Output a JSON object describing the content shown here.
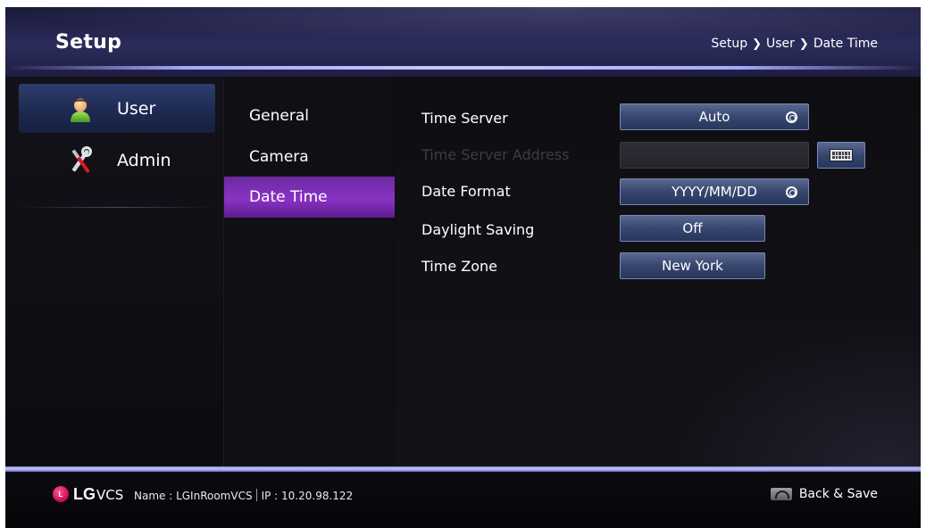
{
  "header": {
    "title": "Setup",
    "breadcrumb": [
      "Setup",
      "User",
      "Date Time"
    ]
  },
  "nav": {
    "items": [
      {
        "label": "User",
        "icon": "user-icon",
        "selected": true
      },
      {
        "label": "Admin",
        "icon": "tools-icon",
        "selected": false
      }
    ]
  },
  "submenu": {
    "items": [
      {
        "label": "General",
        "selected": false
      },
      {
        "label": "Camera",
        "selected": false
      },
      {
        "label": "Date Time",
        "selected": true
      }
    ]
  },
  "settings": {
    "time_server": {
      "label": "Time Server",
      "value": "Auto"
    },
    "time_server_address": {
      "label": "Time Server Address",
      "value": "",
      "disabled": true
    },
    "date_format": {
      "label": "Date Format",
      "value": "YYYY/MM/DD"
    },
    "daylight_saving": {
      "label": "Daylight Saving",
      "value": "Off"
    },
    "time_zone": {
      "label": "Time Zone",
      "value": "New York"
    }
  },
  "footer": {
    "brand": "LG",
    "product": "VCS",
    "name_label": "Name : LGInRoomVCS",
    "ip_label": "IP : 10.20.98.122",
    "back_save": "Back & Save"
  },
  "colors": {
    "selected_submenu": "#8a32c4",
    "selected_nav": "#2e3d6e",
    "field_bg": "#36466e",
    "accent_line": "#c4c4ff"
  }
}
